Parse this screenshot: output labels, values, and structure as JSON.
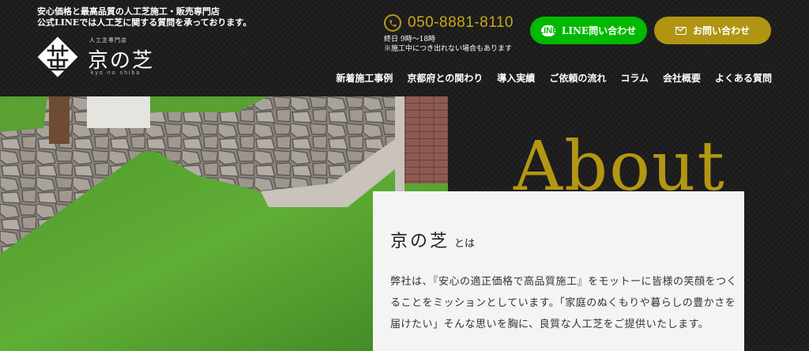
{
  "header": {
    "tagline_line1": "安心価格と最高品質の人工芝施工・販売専門店",
    "tagline_line2": "公式LINEでは人工芝に関する質問を承っております。",
    "logo": {
      "subtitle": "人工芝専門店",
      "name": "京の芝",
      "romaji": "kyo no shiba"
    }
  },
  "contact": {
    "phone_icon": "phone-icon",
    "phone": "050-8881-8110",
    "hours": "終日 9時〜18時",
    "note": "※施工中につき出れない場合もあります"
  },
  "buttons": {
    "line_label": "LINE問い合わせ",
    "mail_label": "お問い合わせ",
    "line_color": "#00b900",
    "mail_color": "#b09412"
  },
  "nav": {
    "items": [
      "新着施工事例",
      "京都府との関わり",
      "導入実績",
      "ご依頼の流れ",
      "コラム",
      "会社概要",
      "よくある質問"
    ]
  },
  "about": {
    "title": "About",
    "brand": "京の芝",
    "brand_suffix": "とは",
    "body": "弊社は、『安心の適正価格で高品質施工』をモットーに皆様の笑顔をつくることをミッションとしています。「家庭のぬくもりや暮らしの豊かさを届けたい」そんな思いを胸に、良質な人工芝をご提供いたします。"
  },
  "colors": {
    "accent_gold": "#b39713",
    "background": "#1e1e1e"
  }
}
